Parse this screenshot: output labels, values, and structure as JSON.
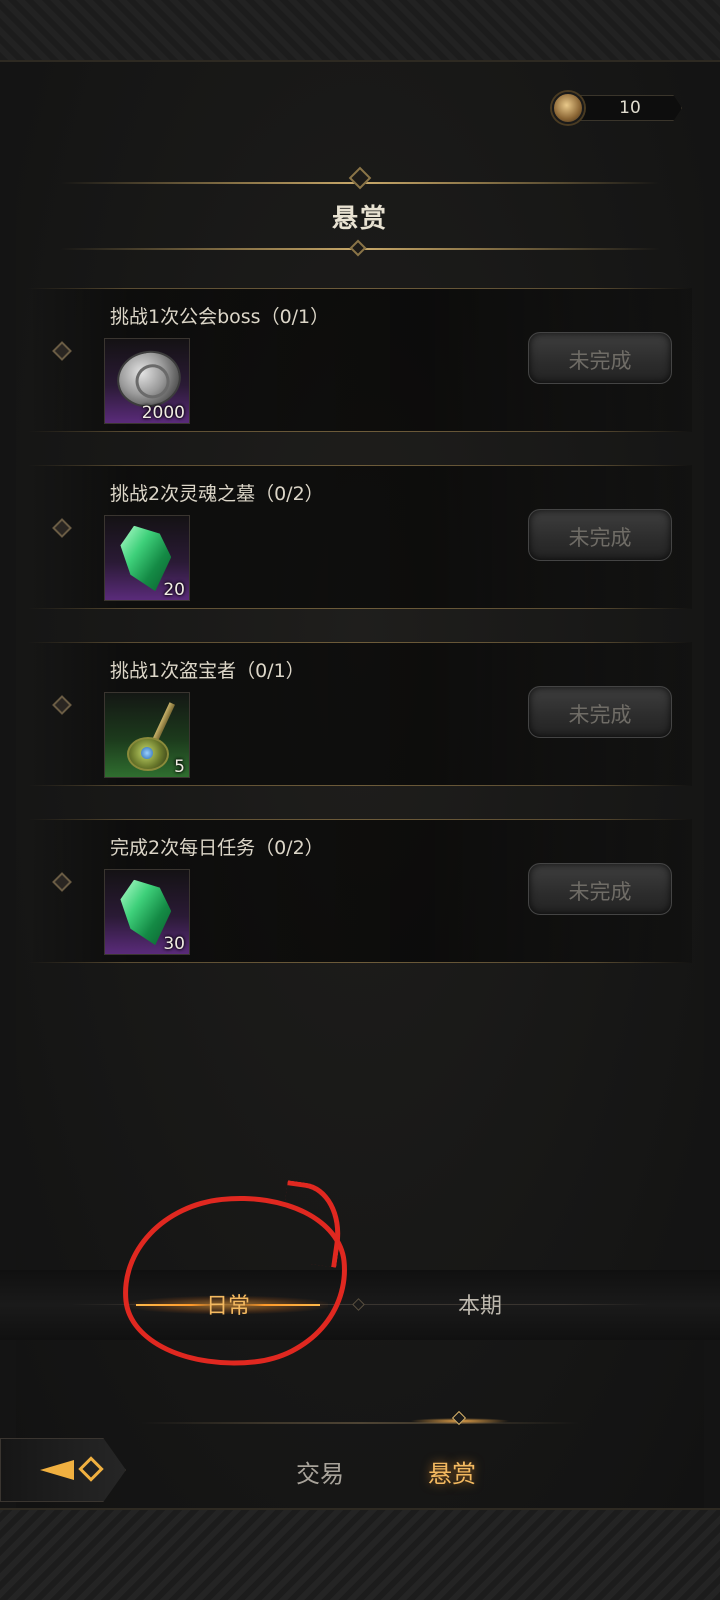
{
  "currency": {
    "icon": "bronze-coin-icon",
    "value": "10"
  },
  "title": "悬赏",
  "tasks": [
    {
      "label": "挑战1次公会boss（0/1）",
      "reward_icon": "silver-coin-icon",
      "reward_count": "2000",
      "status": "未完成"
    },
    {
      "label": "挑战2次灵魂之墓（0/2）",
      "reward_icon": "green-gem-icon",
      "reward_count": "20",
      "status": "未完成"
    },
    {
      "label": "挑战1次盗宝者（0/1）",
      "reward_icon": "scepter-icon",
      "reward_count": "5",
      "status": "未完成"
    },
    {
      "label": "完成2次每日任务（0/2）",
      "reward_icon": "green-gem-icon",
      "reward_count": "30",
      "status": "未完成"
    }
  ],
  "period_tabs": [
    {
      "label": "日常",
      "active": true
    },
    {
      "label": "本期",
      "active": false
    }
  ],
  "bottom_nav": [
    {
      "label": "交易",
      "active": false
    },
    {
      "label": "悬赏",
      "active": true
    }
  ],
  "colors": {
    "accent": "#f3b960",
    "annotation": "#e02820"
  }
}
